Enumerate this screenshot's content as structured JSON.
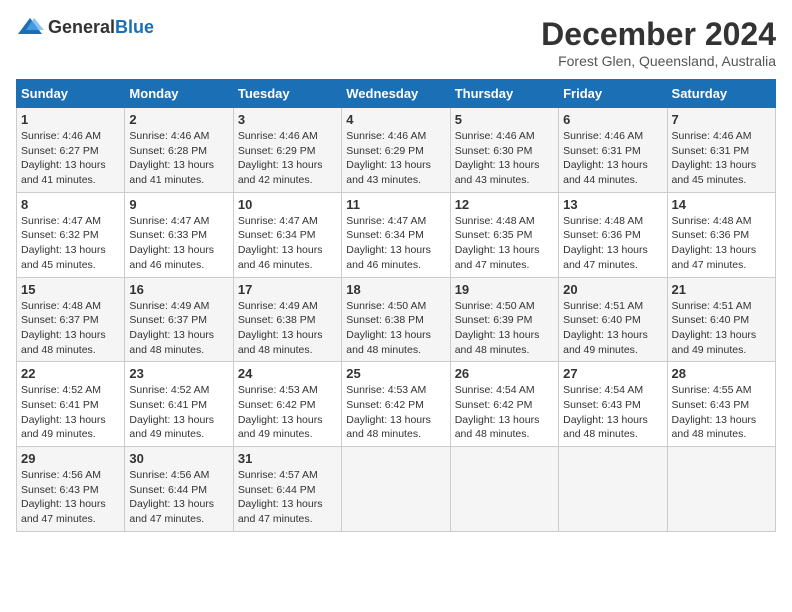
{
  "logo": {
    "text_general": "General",
    "text_blue": "Blue"
  },
  "title": "December 2024",
  "subtitle": "Forest Glen, Queensland, Australia",
  "days_of_week": [
    "Sunday",
    "Monday",
    "Tuesday",
    "Wednesday",
    "Thursday",
    "Friday",
    "Saturday"
  ],
  "weeks": [
    [
      {
        "day": "1",
        "sunrise": "Sunrise: 4:46 AM",
        "sunset": "Sunset: 6:27 PM",
        "daylight": "Daylight: 13 hours and 41 minutes."
      },
      {
        "day": "2",
        "sunrise": "Sunrise: 4:46 AM",
        "sunset": "Sunset: 6:28 PM",
        "daylight": "Daylight: 13 hours and 41 minutes."
      },
      {
        "day": "3",
        "sunrise": "Sunrise: 4:46 AM",
        "sunset": "Sunset: 6:29 PM",
        "daylight": "Daylight: 13 hours and 42 minutes."
      },
      {
        "day": "4",
        "sunrise": "Sunrise: 4:46 AM",
        "sunset": "Sunset: 6:29 PM",
        "daylight": "Daylight: 13 hours and 43 minutes."
      },
      {
        "day": "5",
        "sunrise": "Sunrise: 4:46 AM",
        "sunset": "Sunset: 6:30 PM",
        "daylight": "Daylight: 13 hours and 43 minutes."
      },
      {
        "day": "6",
        "sunrise": "Sunrise: 4:46 AM",
        "sunset": "Sunset: 6:31 PM",
        "daylight": "Daylight: 13 hours and 44 minutes."
      },
      {
        "day": "7",
        "sunrise": "Sunrise: 4:46 AM",
        "sunset": "Sunset: 6:31 PM",
        "daylight": "Daylight: 13 hours and 45 minutes."
      }
    ],
    [
      {
        "day": "8",
        "sunrise": "Sunrise: 4:47 AM",
        "sunset": "Sunset: 6:32 PM",
        "daylight": "Daylight: 13 hours and 45 minutes."
      },
      {
        "day": "9",
        "sunrise": "Sunrise: 4:47 AM",
        "sunset": "Sunset: 6:33 PM",
        "daylight": "Daylight: 13 hours and 46 minutes."
      },
      {
        "day": "10",
        "sunrise": "Sunrise: 4:47 AM",
        "sunset": "Sunset: 6:34 PM",
        "daylight": "Daylight: 13 hours and 46 minutes."
      },
      {
        "day": "11",
        "sunrise": "Sunrise: 4:47 AM",
        "sunset": "Sunset: 6:34 PM",
        "daylight": "Daylight: 13 hours and 46 minutes."
      },
      {
        "day": "12",
        "sunrise": "Sunrise: 4:48 AM",
        "sunset": "Sunset: 6:35 PM",
        "daylight": "Daylight: 13 hours and 47 minutes."
      },
      {
        "day": "13",
        "sunrise": "Sunrise: 4:48 AM",
        "sunset": "Sunset: 6:36 PM",
        "daylight": "Daylight: 13 hours and 47 minutes."
      },
      {
        "day": "14",
        "sunrise": "Sunrise: 4:48 AM",
        "sunset": "Sunset: 6:36 PM",
        "daylight": "Daylight: 13 hours and 47 minutes."
      }
    ],
    [
      {
        "day": "15",
        "sunrise": "Sunrise: 4:48 AM",
        "sunset": "Sunset: 6:37 PM",
        "daylight": "Daylight: 13 hours and 48 minutes."
      },
      {
        "day": "16",
        "sunrise": "Sunrise: 4:49 AM",
        "sunset": "Sunset: 6:37 PM",
        "daylight": "Daylight: 13 hours and 48 minutes."
      },
      {
        "day": "17",
        "sunrise": "Sunrise: 4:49 AM",
        "sunset": "Sunset: 6:38 PM",
        "daylight": "Daylight: 13 hours and 48 minutes."
      },
      {
        "day": "18",
        "sunrise": "Sunrise: 4:50 AM",
        "sunset": "Sunset: 6:38 PM",
        "daylight": "Daylight: 13 hours and 48 minutes."
      },
      {
        "day": "19",
        "sunrise": "Sunrise: 4:50 AM",
        "sunset": "Sunset: 6:39 PM",
        "daylight": "Daylight: 13 hours and 48 minutes."
      },
      {
        "day": "20",
        "sunrise": "Sunrise: 4:51 AM",
        "sunset": "Sunset: 6:40 PM",
        "daylight": "Daylight: 13 hours and 49 minutes."
      },
      {
        "day": "21",
        "sunrise": "Sunrise: 4:51 AM",
        "sunset": "Sunset: 6:40 PM",
        "daylight": "Daylight: 13 hours and 49 minutes."
      }
    ],
    [
      {
        "day": "22",
        "sunrise": "Sunrise: 4:52 AM",
        "sunset": "Sunset: 6:41 PM",
        "daylight": "Daylight: 13 hours and 49 minutes."
      },
      {
        "day": "23",
        "sunrise": "Sunrise: 4:52 AM",
        "sunset": "Sunset: 6:41 PM",
        "daylight": "Daylight: 13 hours and 49 minutes."
      },
      {
        "day": "24",
        "sunrise": "Sunrise: 4:53 AM",
        "sunset": "Sunset: 6:42 PM",
        "daylight": "Daylight: 13 hours and 49 minutes."
      },
      {
        "day": "25",
        "sunrise": "Sunrise: 4:53 AM",
        "sunset": "Sunset: 6:42 PM",
        "daylight": "Daylight: 13 hours and 48 minutes."
      },
      {
        "day": "26",
        "sunrise": "Sunrise: 4:54 AM",
        "sunset": "Sunset: 6:42 PM",
        "daylight": "Daylight: 13 hours and 48 minutes."
      },
      {
        "day": "27",
        "sunrise": "Sunrise: 4:54 AM",
        "sunset": "Sunset: 6:43 PM",
        "daylight": "Daylight: 13 hours and 48 minutes."
      },
      {
        "day": "28",
        "sunrise": "Sunrise: 4:55 AM",
        "sunset": "Sunset: 6:43 PM",
        "daylight": "Daylight: 13 hours and 48 minutes."
      }
    ],
    [
      {
        "day": "29",
        "sunrise": "Sunrise: 4:56 AM",
        "sunset": "Sunset: 6:43 PM",
        "daylight": "Daylight: 13 hours and 47 minutes."
      },
      {
        "day": "30",
        "sunrise": "Sunrise: 4:56 AM",
        "sunset": "Sunset: 6:44 PM",
        "daylight": "Daylight: 13 hours and 47 minutes."
      },
      {
        "day": "31",
        "sunrise": "Sunrise: 4:57 AM",
        "sunset": "Sunset: 6:44 PM",
        "daylight": "Daylight: 13 hours and 47 minutes."
      },
      null,
      null,
      null,
      null
    ]
  ]
}
